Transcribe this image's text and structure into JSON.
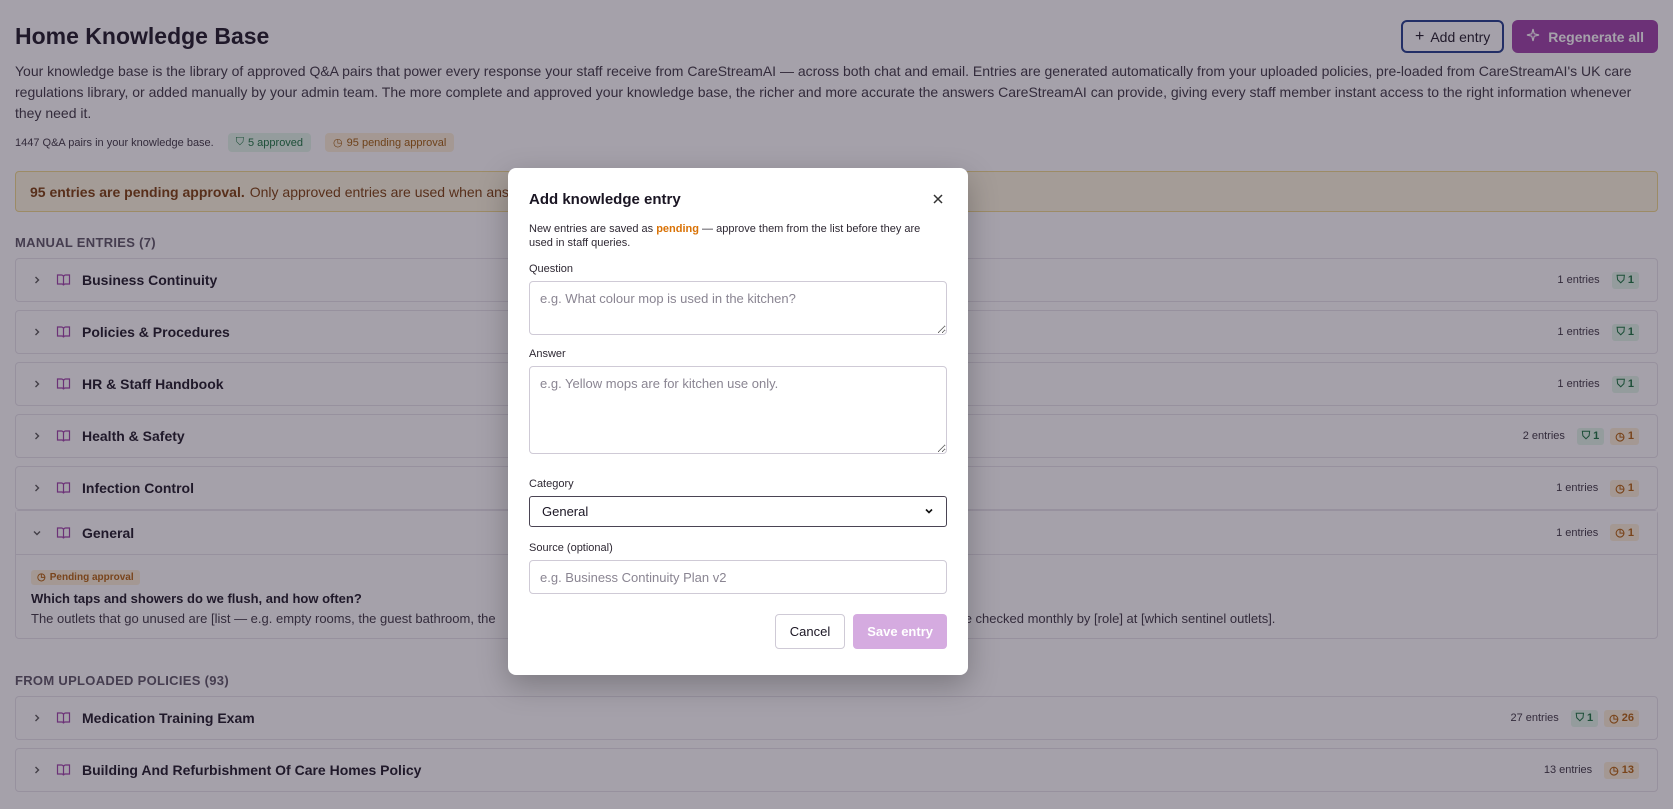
{
  "header": {
    "title": "Home Knowledge Base",
    "add_entry_label": "Add entry",
    "regenerate_label": "Regenerate all",
    "description": "Your knowledge base is the library of approved Q&A pairs that power every response your staff receive from CareStreamAI — across both chat and email. Entries are generated automatically from your uploaded policies, pre-loaded from CareStreamAI's UK care regulations library, or added manually by your admin team. The more complete and approved your knowledge base, the richer and more accurate the answers CareStreamAI can provide, giving every staff member instant access to the right information whenever they need it."
  },
  "stats": {
    "total": "1447 Q&A pairs in your knowledge base.",
    "approved": "5 approved",
    "pending": "95 pending approval"
  },
  "alert": {
    "bold": "95 entries are pending approval.",
    "text": "Only approved entries are used when answeri"
  },
  "manual": {
    "title": "MANUAL ENTRIES (7)",
    "rows": [
      {
        "name": "Business Continuity",
        "count": "1 entries",
        "approved": "1",
        "pending": ""
      },
      {
        "name": "Policies & Procedures",
        "count": "1 entries",
        "approved": "1",
        "pending": ""
      },
      {
        "name": "HR & Staff Handbook",
        "count": "1 entries",
        "approved": "1",
        "pending": ""
      },
      {
        "name": "Health & Safety",
        "count": "2 entries",
        "approved": "1",
        "pending": "1"
      },
      {
        "name": "Infection Control",
        "count": "1 entries",
        "approved": "",
        "pending": "1"
      }
    ],
    "expanded": {
      "name": "General",
      "count": "1 entries",
      "pending": "1",
      "entry": {
        "status": "Pending approval",
        "question": "Which taps and showers do we flush, and how often?",
        "answer_start": "The outlets that go unused are [list — e.g. empty rooms, the guest bathroom, the",
        "answer_end": "ere]. Temperatures are checked monthly by [role] at [which sentinel outlets]."
      }
    }
  },
  "uploaded": {
    "title": "FROM UPLOADED POLICIES (93)",
    "rows": [
      {
        "name": "Medication Training Exam",
        "count": "27 entries",
        "approved": "1",
        "pending": "26"
      },
      {
        "name": "Building And Refurbishment Of Care Homes Policy",
        "count": "13 entries",
        "approved": "",
        "pending": "13"
      }
    ]
  },
  "modal": {
    "title": "Add knowledge entry",
    "note_prefix": "New entries are saved as",
    "note_pending": "pending",
    "note_suffix": "— approve them from the list before they are used in staff queries.",
    "question_label": "Question",
    "question_placeholder": "e.g. What colour mop is used in the kitchen?",
    "answer_label": "Answer",
    "answer_placeholder": "e.g. Yellow mops are for kitchen use only.",
    "category_label": "Category",
    "category_value": "General",
    "source_label": "Source (optional)",
    "source_placeholder": "e.g. Business Continuity Plan v2",
    "cancel_label": "Cancel",
    "save_label": "Save entry"
  },
  "colors": {
    "accent": "#9d3fa8",
    "approved": "#17733d",
    "pending": "#b4600a"
  }
}
